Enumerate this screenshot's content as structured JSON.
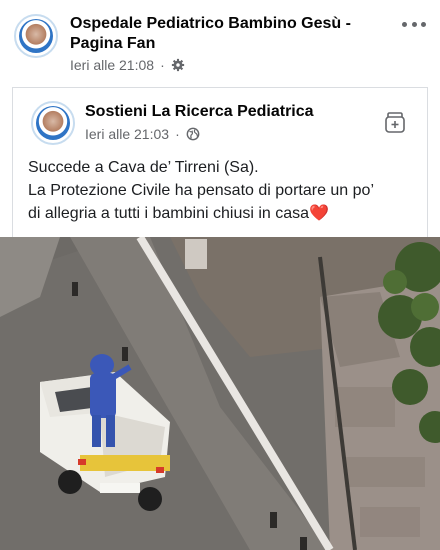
{
  "post": {
    "page_name": "Ospedale Pediatrico Bambino Gesù - Pagina Fan",
    "timestamp": "Ieri alle 21:08",
    "privacy_icon": "gear-icon",
    "more_icon": "more-horizontal-icon"
  },
  "shared": {
    "name": "Sostieni La Ricerca Pediatrica",
    "timestamp": "Ieri alle 21:03",
    "privacy_icon": "globe-icon",
    "action_icon": "save-icon",
    "text_lines": [
      "Succede a Cava de’ Tirreni (Sa).",
      "La Protezione Civile ha pensato di portare un po’",
      "di allegria a tutti i bambini chiusi in casa"
    ],
    "emoji": "❤️"
  },
  "colors": {
    "text": "#050505",
    "meta": "#65676b",
    "heart": "#d9243e",
    "border": "#dadde1"
  }
}
